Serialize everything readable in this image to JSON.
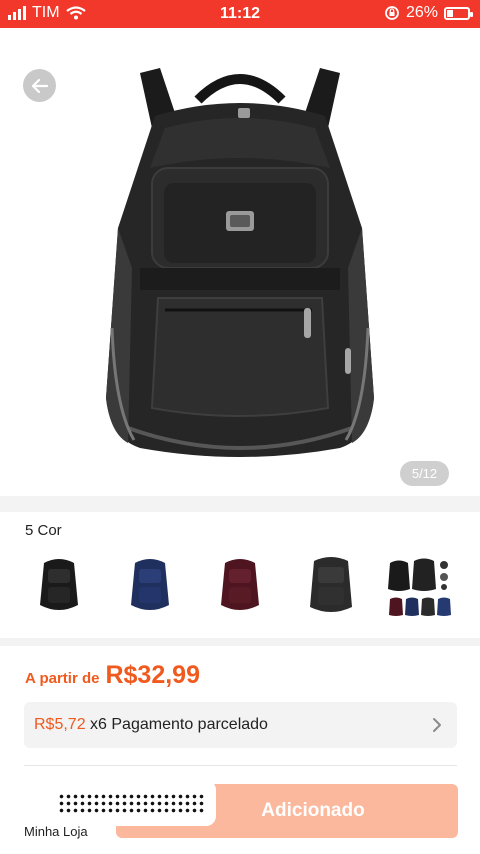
{
  "status_bar": {
    "carrier": "TIM",
    "time": "11:12",
    "battery_percent": "26%",
    "battery_level": 0.26,
    "background_color": "#f2382a"
  },
  "product": {
    "image_icon": "backpack-photo",
    "pager": "5/12"
  },
  "colors": {
    "title": "5 Cor",
    "options": [
      {
        "name": "black-backpack-swatch",
        "color": "#1a1a1a"
      },
      {
        "name": "blue-backpack-swatch",
        "color": "#1f2f5e"
      },
      {
        "name": "wine-backpack-swatch",
        "color": "#4e1520"
      },
      {
        "name": "dark-gray-backpack-swatch",
        "color": "#2b2b2b"
      },
      {
        "name": "all-colors-swatch",
        "color": "#333333"
      }
    ]
  },
  "price": {
    "prefix": "A partir de",
    "value": "R$32,99",
    "color": "#f05a1e"
  },
  "installment": {
    "amount": "R$5,72",
    "text": " x6 Pagamento parcelado"
  },
  "bottom_bar": {
    "store_label": "Minha Loja",
    "button_label": "Adicionado",
    "button_color": "#fbb89c"
  }
}
